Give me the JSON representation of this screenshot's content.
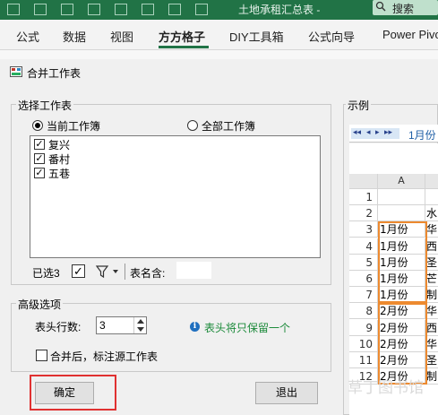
{
  "titlebar": {
    "title": "土地承租汇总表 -",
    "search": "搜索",
    "colors": {
      "bar": "#217346"
    }
  },
  "ribbon": {
    "tabs": [
      {
        "label": "公式"
      },
      {
        "label": "数据"
      },
      {
        "label": "视图"
      },
      {
        "label": "方方格子"
      },
      {
        "label": "DIY工具箱"
      },
      {
        "label": "公式向导"
      },
      {
        "label": "Power Pivot"
      }
    ],
    "active_tab": "方方格子"
  },
  "dialog": {
    "title": "合并工作表",
    "select_group": "选择工作表",
    "radio_current": "当前工作簿",
    "radio_all": "全部工作簿",
    "sheets": [
      {
        "label": "复兴",
        "checked": true
      },
      {
        "label": "番村",
        "checked": true
      },
      {
        "label": "五巷",
        "checked": true
      }
    ],
    "selected_count": "已选3",
    "sheet_name_label": "表名含:",
    "sheet_name_value": "",
    "advanced_group": "高级选项",
    "header_rows_label": "表头行数:",
    "header_rows_value": "3",
    "info_text": "表头将只保留一个",
    "mark_source_label": "合并后，标注源工作表",
    "ok_button": "确定",
    "exit_button": "退出",
    "preview_group": "示例",
    "preview_sheet_tab": "1月份"
  },
  "preview": {
    "col_a": "A",
    "rows": [
      {
        "n": "1",
        "a": "",
        "b": ""
      },
      {
        "n": "2",
        "a": "",
        "b": "水"
      },
      {
        "n": "3",
        "a": "1月份",
        "b": "华"
      },
      {
        "n": "4",
        "a": "1月份",
        "b": "西"
      },
      {
        "n": "5",
        "a": "1月份",
        "b": "圣"
      },
      {
        "n": "6",
        "a": "1月份",
        "b": "芒"
      },
      {
        "n": "7",
        "a": "1月份",
        "b": "制"
      },
      {
        "n": "8",
        "a": "2月份",
        "b": "华"
      },
      {
        "n": "9",
        "a": "2月份",
        "b": "西"
      },
      {
        "n": "10",
        "a": "2月份",
        "b": "华"
      },
      {
        "n": "11",
        "a": "2月份",
        "b": "圣"
      },
      {
        "n": "12",
        "a": "2月份",
        "b": "制"
      }
    ],
    "watermark": "草丁图书馆"
  }
}
